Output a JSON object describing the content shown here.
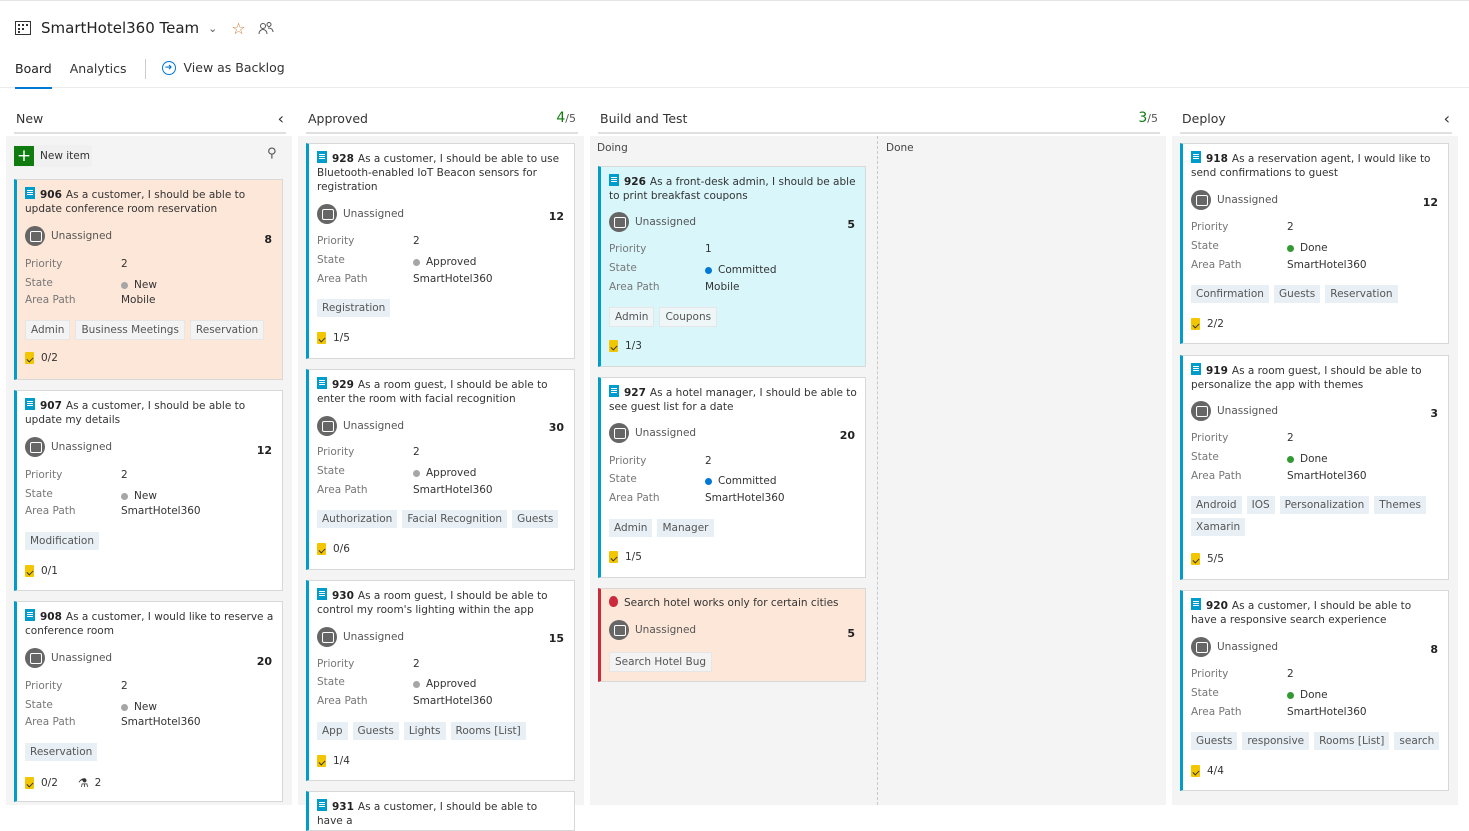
{
  "header": {
    "team_name": "SmartHotel360 Team",
    "tabs": [
      "Board",
      "Analytics"
    ],
    "backlog_link": "View as Backlog",
    "icons": [
      "board-icon",
      "chevron-down-icon",
      "star-icon",
      "team-icon"
    ]
  },
  "columns": {
    "new": {
      "title": "New",
      "collapse": "‹"
    },
    "approved": {
      "title": "Approved",
      "count": "4",
      "limit": "/5"
    },
    "build": {
      "title": "Build and Test",
      "count": "3",
      "limit": "/5",
      "doing": "Doing",
      "done": "Done"
    },
    "deploy": {
      "title": "Deploy",
      "collapse": "‹"
    }
  },
  "new_item_label": "New item",
  "labels": {
    "priority": "Priority",
    "state": "State",
    "area": "Area Path",
    "unassigned": "Unassigned"
  },
  "colors": {
    "new": "#a6a6a6",
    "approved": "#a6a6a6",
    "committed": "#0078d4",
    "done": "#339933",
    "accent": "#0078d4",
    "story": "#009ccc",
    "bug": "#cc293d"
  },
  "cards": {
    "c906": {
      "id": "906",
      "title": "As a customer, I should be able to update conference room reservation",
      "assignee": "Unassigned",
      "est": "8",
      "priority": "2",
      "state": "New",
      "area": "Mobile",
      "tags": [
        "Admin",
        "Business Meetings",
        "Reservation"
      ],
      "tasks": "0/2"
    },
    "c907": {
      "id": "907",
      "title": "As a customer, I should be able to update my details",
      "assignee": "Unassigned",
      "est": "12",
      "priority": "2",
      "state": "New",
      "area": "SmartHotel360",
      "tags": [
        "Modification"
      ],
      "tasks": "0/1"
    },
    "c908": {
      "id": "908",
      "title": "As a customer, I would like to reserve a conference room",
      "assignee": "Unassigned",
      "est": "20",
      "priority": "2",
      "state": "New",
      "area": "SmartHotel360",
      "tags": [
        "Reservation"
      ],
      "tasks": "0/2",
      "tests": "2"
    },
    "c928": {
      "id": "928",
      "title": "As a customer, I should be able to use Bluetooth-enabled IoT Beacon sensors for registration",
      "assignee": "Unassigned",
      "est": "12",
      "priority": "2",
      "state": "Approved",
      "area": "SmartHotel360",
      "tags": [
        "Registration"
      ],
      "tasks": "1/5"
    },
    "c929": {
      "id": "929",
      "title": "As a room guest, I should be able to enter the room with facial recognition",
      "assignee": "Unassigned",
      "est": "30",
      "priority": "2",
      "state": "Approved",
      "area": "SmartHotel360",
      "tags": [
        "Authorization",
        "Facial Recognition",
        "Guests"
      ],
      "tasks": "0/6"
    },
    "c930": {
      "id": "930",
      "title": "As a room guest, I should be able to control my room's lighting within the app",
      "assignee": "Unassigned",
      "est": "15",
      "priority": "2",
      "state": "Approved",
      "area": "SmartHotel360",
      "tags": [
        "App",
        "Guests",
        "Lights",
        "Rooms [List]"
      ],
      "tasks": "1/4"
    },
    "c931": {
      "id": "931",
      "title": "As a customer, I should be able to have a"
    },
    "c926": {
      "id": "926",
      "title": "As a front-desk admin, I should be able to print breakfast coupons",
      "assignee": "Unassigned",
      "est": "5",
      "priority": "1",
      "state": "Committed",
      "area": "Mobile",
      "tags": [
        "Admin",
        "Coupons"
      ],
      "tasks": "1/3"
    },
    "c927": {
      "id": "927",
      "title": "As a hotel manager, I should be able to see guest list for a date",
      "assignee": "Unassigned",
      "est": "20",
      "priority": "2",
      "state": "Committed",
      "area": "SmartHotel360",
      "tags": [
        "Admin",
        "Manager"
      ],
      "tasks": "1/5"
    },
    "bug": {
      "title": "Search hotel works only for certain cities",
      "assignee": "Unassigned",
      "est": "5",
      "tags": [
        "Search Hotel Bug"
      ]
    },
    "c918": {
      "id": "918",
      "title": "As a reservation agent, I would like to send confirmations to guest",
      "assignee": "Unassigned",
      "est": "12",
      "priority": "2",
      "state": "Done",
      "area": "SmartHotel360",
      "tags": [
        "Confirmation",
        "Guests",
        "Reservation"
      ],
      "tasks": "2/2"
    },
    "c919": {
      "id": "919",
      "title": "As a room guest, I should be able to personalize the app with themes",
      "assignee": "Unassigned",
      "est": "3",
      "priority": "2",
      "state": "Done",
      "area": "SmartHotel360",
      "tags": [
        "Android",
        "IOS",
        "Personalization",
        "Themes",
        "Xamarin"
      ],
      "tasks": "5/5"
    },
    "c920": {
      "id": "920",
      "title": "As a customer, I should be able to have a responsive search experience",
      "assignee": "Unassigned",
      "est": "8",
      "priority": "2",
      "state": "Done",
      "area": "SmartHotel360",
      "tags": [
        "Guests",
        "responsive",
        "Rooms [List]",
        "search"
      ],
      "tasks": "4/4"
    }
  }
}
